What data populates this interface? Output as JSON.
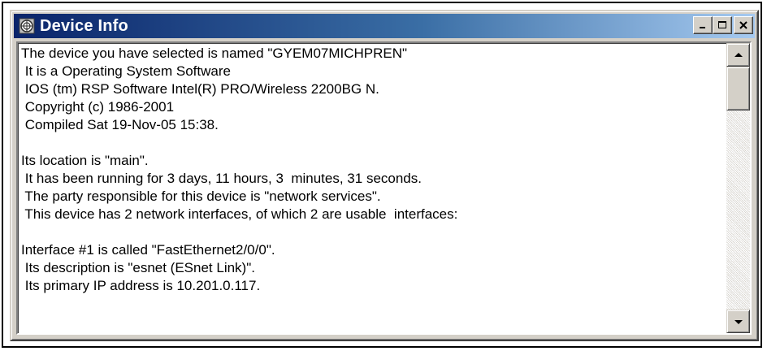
{
  "window": {
    "title": "Device Info",
    "icon": "app-icon"
  },
  "title_buttons": [
    {
      "name": "minimize-button",
      "icon": "minimize-icon"
    },
    {
      "name": "maximize-button",
      "icon": "maximize-icon"
    },
    {
      "name": "close-button",
      "icon": "close-icon"
    }
  ],
  "content": {
    "lines": [
      "The device you have selected is named \"GYEM07MICHPREN\"",
      " It is a Operating System Software",
      " IOS (tm) RSP Software Intel(R) PRO/Wireless 2200BG N.",
      " Copyright (c) 1986-2001",
      " Compiled Sat 19-Nov-05 15:38.",
      "",
      "Its location is \"main\".",
      " It has been running for 3 days, 11 hours, 3  minutes, 31 seconds.",
      " The party responsible for this device is \"network services\".",
      " This device has 2 network interfaces, of which 2 are usable  interfaces:",
      "",
      "Interface #1 is called \"FastEthernet2/0/0\".",
      " Its description is \"esnet (ESnet Link)\".",
      " Its primary IP address is 10.201.0.117."
    ]
  },
  "scrollbar": {
    "up_icon": "scroll-up-arrow-icon",
    "down_icon": "scroll-down-arrow-icon"
  }
}
